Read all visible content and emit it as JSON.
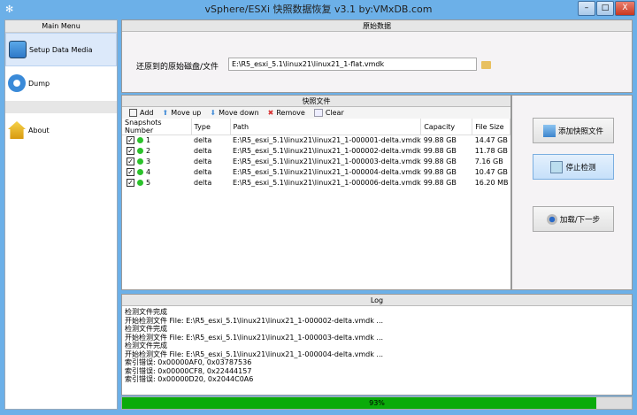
{
  "window": {
    "title": "vSphere/ESXi 快照数据恢复 v3.1 by:VMxDB.com",
    "minimize": "–",
    "maximize": "□",
    "close": "X"
  },
  "sidebar": {
    "header": "Main Menu",
    "items": [
      {
        "label": "Setup Data Media",
        "icon": "table-icon",
        "selected": true
      },
      {
        "label": "Dump",
        "icon": "gear-icon"
      },
      {
        "label": "About",
        "icon": "house-icon"
      }
    ]
  },
  "source": {
    "header": "原始数据",
    "label": "还原到的原始磁盘/文件",
    "value": "E:\\R5_esxi_5.1\\linux21\\linux21_1-flat.vmdk",
    "browse_icon": "folder-icon"
  },
  "snapshots": {
    "header": "快照文件",
    "toolbar": [
      {
        "label": "Add",
        "icon": "add-icon"
      },
      {
        "label": "Move up",
        "icon": "arrow-up-icon"
      },
      {
        "label": "Move down",
        "icon": "arrow-down-icon"
      },
      {
        "label": "Remove",
        "icon": "remove-icon"
      },
      {
        "label": "Clear",
        "icon": "clear-icon"
      }
    ],
    "columns": [
      "Snapshots Number",
      "Type",
      "Path",
      "Capacity",
      "File Size"
    ],
    "rows": [
      {
        "num": "1",
        "type": "delta",
        "path": "E:\\R5_esxi_5.1\\linux21\\linux21_1-000001-delta.vmdk",
        "capacity": "99.88 GB",
        "size": "14.47 GB",
        "checked": true
      },
      {
        "num": "2",
        "type": "delta",
        "path": "E:\\R5_esxi_5.1\\linux21\\linux21_1-000002-delta.vmdk",
        "capacity": "99.88 GB",
        "size": "11.78 GB",
        "checked": true
      },
      {
        "num": "3",
        "type": "delta",
        "path": "E:\\R5_esxi_5.1\\linux21\\linux21_1-000003-delta.vmdk",
        "capacity": "99.88 GB",
        "size": "7.16 GB",
        "checked": true
      },
      {
        "num": "4",
        "type": "delta",
        "path": "E:\\R5_esxi_5.1\\linux21\\linux21_1-000004-delta.vmdk",
        "capacity": "99.88 GB",
        "size": "10.47 GB",
        "checked": true
      },
      {
        "num": "5",
        "type": "delta",
        "path": "E:\\R5_esxi_5.1\\linux21\\linux21_1-000006-delta.vmdk",
        "capacity": "99.88 GB",
        "size": "16.20 MB",
        "checked": true
      }
    ]
  },
  "actions": {
    "add_snapshot": "添加快照文件",
    "stop_detect": "停止检测",
    "load_next": "加载/下一步"
  },
  "log": {
    "header": "Log",
    "lines": [
      "检测文件完成",
      "开始检测文件 File: E:\\R5_esxi_5.1\\linux21\\linux21_1-000002-delta.vmdk ...",
      "检测文件完成",
      "开始检测文件 File: E:\\R5_esxi_5.1\\linux21\\linux21_1-000003-delta.vmdk ...",
      "检测文件完成",
      "开始检测文件 File: E:\\R5_esxi_5.1\\linux21\\linux21_1-000004-delta.vmdk ...",
      "索引错误: 0x00000AF0, 0x03787536",
      "索引错误: 0x00000CF8, 0x22444157",
      "索引错误: 0x00000D20, 0x2044C0A6"
    ]
  },
  "progress": {
    "value": 93,
    "label": "93%",
    "color": "#0aab0a"
  }
}
